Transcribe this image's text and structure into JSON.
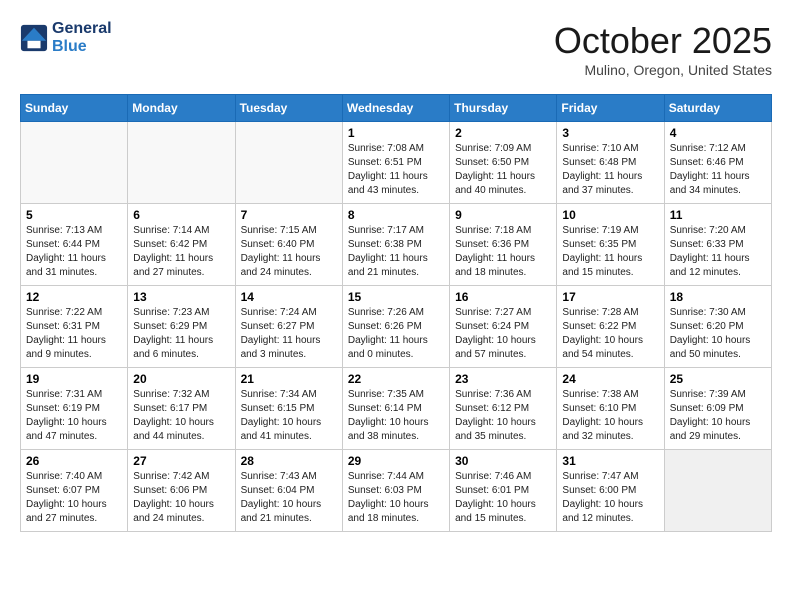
{
  "header": {
    "logo_line1": "General",
    "logo_line2": "Blue",
    "month_title": "October 2025",
    "location": "Mulino, Oregon, United States"
  },
  "weekdays": [
    "Sunday",
    "Monday",
    "Tuesday",
    "Wednesday",
    "Thursday",
    "Friday",
    "Saturday"
  ],
  "weeks": [
    [
      {
        "day": "",
        "info": "",
        "empty": true
      },
      {
        "day": "",
        "info": "",
        "empty": true
      },
      {
        "day": "",
        "info": "",
        "empty": true
      },
      {
        "day": "1",
        "info": "Sunrise: 7:08 AM\nSunset: 6:51 PM\nDaylight: 11 hours\nand 43 minutes.",
        "empty": false
      },
      {
        "day": "2",
        "info": "Sunrise: 7:09 AM\nSunset: 6:50 PM\nDaylight: 11 hours\nand 40 minutes.",
        "empty": false
      },
      {
        "day": "3",
        "info": "Sunrise: 7:10 AM\nSunset: 6:48 PM\nDaylight: 11 hours\nand 37 minutes.",
        "empty": false
      },
      {
        "day": "4",
        "info": "Sunrise: 7:12 AM\nSunset: 6:46 PM\nDaylight: 11 hours\nand 34 minutes.",
        "empty": false
      }
    ],
    [
      {
        "day": "5",
        "info": "Sunrise: 7:13 AM\nSunset: 6:44 PM\nDaylight: 11 hours\nand 31 minutes.",
        "empty": false
      },
      {
        "day": "6",
        "info": "Sunrise: 7:14 AM\nSunset: 6:42 PM\nDaylight: 11 hours\nand 27 minutes.",
        "empty": false
      },
      {
        "day": "7",
        "info": "Sunrise: 7:15 AM\nSunset: 6:40 PM\nDaylight: 11 hours\nand 24 minutes.",
        "empty": false
      },
      {
        "day": "8",
        "info": "Sunrise: 7:17 AM\nSunset: 6:38 PM\nDaylight: 11 hours\nand 21 minutes.",
        "empty": false
      },
      {
        "day": "9",
        "info": "Sunrise: 7:18 AM\nSunset: 6:36 PM\nDaylight: 11 hours\nand 18 minutes.",
        "empty": false
      },
      {
        "day": "10",
        "info": "Sunrise: 7:19 AM\nSunset: 6:35 PM\nDaylight: 11 hours\nand 15 minutes.",
        "empty": false
      },
      {
        "day": "11",
        "info": "Sunrise: 7:20 AM\nSunset: 6:33 PM\nDaylight: 11 hours\nand 12 minutes.",
        "empty": false
      }
    ],
    [
      {
        "day": "12",
        "info": "Sunrise: 7:22 AM\nSunset: 6:31 PM\nDaylight: 11 hours\nand 9 minutes.",
        "empty": false
      },
      {
        "day": "13",
        "info": "Sunrise: 7:23 AM\nSunset: 6:29 PM\nDaylight: 11 hours\nand 6 minutes.",
        "empty": false
      },
      {
        "day": "14",
        "info": "Sunrise: 7:24 AM\nSunset: 6:27 PM\nDaylight: 11 hours\nand 3 minutes.",
        "empty": false
      },
      {
        "day": "15",
        "info": "Sunrise: 7:26 AM\nSunset: 6:26 PM\nDaylight: 11 hours\nand 0 minutes.",
        "empty": false
      },
      {
        "day": "16",
        "info": "Sunrise: 7:27 AM\nSunset: 6:24 PM\nDaylight: 10 hours\nand 57 minutes.",
        "empty": false
      },
      {
        "day": "17",
        "info": "Sunrise: 7:28 AM\nSunset: 6:22 PM\nDaylight: 10 hours\nand 54 minutes.",
        "empty": false
      },
      {
        "day": "18",
        "info": "Sunrise: 7:30 AM\nSunset: 6:20 PM\nDaylight: 10 hours\nand 50 minutes.",
        "empty": false
      }
    ],
    [
      {
        "day": "19",
        "info": "Sunrise: 7:31 AM\nSunset: 6:19 PM\nDaylight: 10 hours\nand 47 minutes.",
        "empty": false
      },
      {
        "day": "20",
        "info": "Sunrise: 7:32 AM\nSunset: 6:17 PM\nDaylight: 10 hours\nand 44 minutes.",
        "empty": false
      },
      {
        "day": "21",
        "info": "Sunrise: 7:34 AM\nSunset: 6:15 PM\nDaylight: 10 hours\nand 41 minutes.",
        "empty": false
      },
      {
        "day": "22",
        "info": "Sunrise: 7:35 AM\nSunset: 6:14 PM\nDaylight: 10 hours\nand 38 minutes.",
        "empty": false
      },
      {
        "day": "23",
        "info": "Sunrise: 7:36 AM\nSunset: 6:12 PM\nDaylight: 10 hours\nand 35 minutes.",
        "empty": false
      },
      {
        "day": "24",
        "info": "Sunrise: 7:38 AM\nSunset: 6:10 PM\nDaylight: 10 hours\nand 32 minutes.",
        "empty": false
      },
      {
        "day": "25",
        "info": "Sunrise: 7:39 AM\nSunset: 6:09 PM\nDaylight: 10 hours\nand 29 minutes.",
        "empty": false
      }
    ],
    [
      {
        "day": "26",
        "info": "Sunrise: 7:40 AM\nSunset: 6:07 PM\nDaylight: 10 hours\nand 27 minutes.",
        "empty": false
      },
      {
        "day": "27",
        "info": "Sunrise: 7:42 AM\nSunset: 6:06 PM\nDaylight: 10 hours\nand 24 minutes.",
        "empty": false
      },
      {
        "day": "28",
        "info": "Sunrise: 7:43 AM\nSunset: 6:04 PM\nDaylight: 10 hours\nand 21 minutes.",
        "empty": false
      },
      {
        "day": "29",
        "info": "Sunrise: 7:44 AM\nSunset: 6:03 PM\nDaylight: 10 hours\nand 18 minutes.",
        "empty": false
      },
      {
        "day": "30",
        "info": "Sunrise: 7:46 AM\nSunset: 6:01 PM\nDaylight: 10 hours\nand 15 minutes.",
        "empty": false
      },
      {
        "day": "31",
        "info": "Sunrise: 7:47 AM\nSunset: 6:00 PM\nDaylight: 10 hours\nand 12 minutes.",
        "empty": false
      },
      {
        "day": "",
        "info": "",
        "empty": true
      }
    ]
  ]
}
